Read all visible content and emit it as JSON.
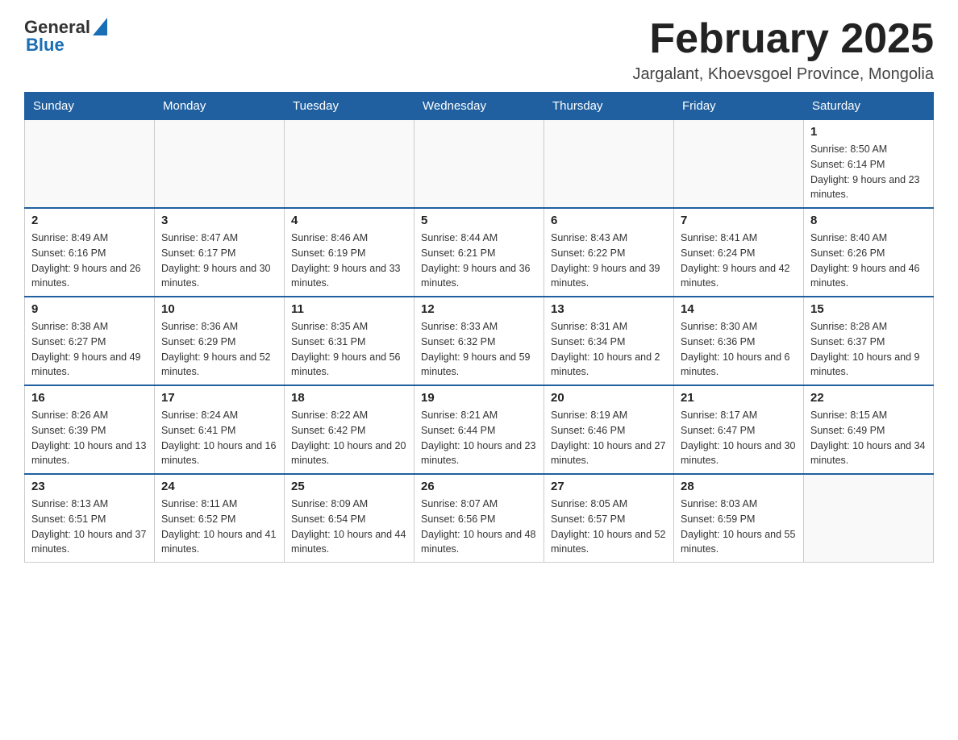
{
  "header": {
    "logo": {
      "general": "General",
      "blue": "Blue"
    },
    "title": "February 2025",
    "location": "Jargalant, Khoevsgoel Province, Mongolia"
  },
  "weekdays": [
    "Sunday",
    "Monday",
    "Tuesday",
    "Wednesday",
    "Thursday",
    "Friday",
    "Saturday"
  ],
  "weeks": [
    {
      "days": [
        {
          "number": "",
          "sunrise": "",
          "sunset": "",
          "daylight": "",
          "empty": true
        },
        {
          "number": "",
          "sunrise": "",
          "sunset": "",
          "daylight": "",
          "empty": true
        },
        {
          "number": "",
          "sunrise": "",
          "sunset": "",
          "daylight": "",
          "empty": true
        },
        {
          "number": "",
          "sunrise": "",
          "sunset": "",
          "daylight": "",
          "empty": true
        },
        {
          "number": "",
          "sunrise": "",
          "sunset": "",
          "daylight": "",
          "empty": true
        },
        {
          "number": "",
          "sunrise": "",
          "sunset": "",
          "daylight": "",
          "empty": true
        },
        {
          "number": "1",
          "sunrise": "Sunrise: 8:50 AM",
          "sunset": "Sunset: 6:14 PM",
          "daylight": "Daylight: 9 hours and 23 minutes.",
          "empty": false
        }
      ]
    },
    {
      "days": [
        {
          "number": "2",
          "sunrise": "Sunrise: 8:49 AM",
          "sunset": "Sunset: 6:16 PM",
          "daylight": "Daylight: 9 hours and 26 minutes.",
          "empty": false
        },
        {
          "number": "3",
          "sunrise": "Sunrise: 8:47 AM",
          "sunset": "Sunset: 6:17 PM",
          "daylight": "Daylight: 9 hours and 30 minutes.",
          "empty": false
        },
        {
          "number": "4",
          "sunrise": "Sunrise: 8:46 AM",
          "sunset": "Sunset: 6:19 PM",
          "daylight": "Daylight: 9 hours and 33 minutes.",
          "empty": false
        },
        {
          "number": "5",
          "sunrise": "Sunrise: 8:44 AM",
          "sunset": "Sunset: 6:21 PM",
          "daylight": "Daylight: 9 hours and 36 minutes.",
          "empty": false
        },
        {
          "number": "6",
          "sunrise": "Sunrise: 8:43 AM",
          "sunset": "Sunset: 6:22 PM",
          "daylight": "Daylight: 9 hours and 39 minutes.",
          "empty": false
        },
        {
          "number": "7",
          "sunrise": "Sunrise: 8:41 AM",
          "sunset": "Sunset: 6:24 PM",
          "daylight": "Daylight: 9 hours and 42 minutes.",
          "empty": false
        },
        {
          "number": "8",
          "sunrise": "Sunrise: 8:40 AM",
          "sunset": "Sunset: 6:26 PM",
          "daylight": "Daylight: 9 hours and 46 minutes.",
          "empty": false
        }
      ]
    },
    {
      "days": [
        {
          "number": "9",
          "sunrise": "Sunrise: 8:38 AM",
          "sunset": "Sunset: 6:27 PM",
          "daylight": "Daylight: 9 hours and 49 minutes.",
          "empty": false
        },
        {
          "number": "10",
          "sunrise": "Sunrise: 8:36 AM",
          "sunset": "Sunset: 6:29 PM",
          "daylight": "Daylight: 9 hours and 52 minutes.",
          "empty": false
        },
        {
          "number": "11",
          "sunrise": "Sunrise: 8:35 AM",
          "sunset": "Sunset: 6:31 PM",
          "daylight": "Daylight: 9 hours and 56 minutes.",
          "empty": false
        },
        {
          "number": "12",
          "sunrise": "Sunrise: 8:33 AM",
          "sunset": "Sunset: 6:32 PM",
          "daylight": "Daylight: 9 hours and 59 minutes.",
          "empty": false
        },
        {
          "number": "13",
          "sunrise": "Sunrise: 8:31 AM",
          "sunset": "Sunset: 6:34 PM",
          "daylight": "Daylight: 10 hours and 2 minutes.",
          "empty": false
        },
        {
          "number": "14",
          "sunrise": "Sunrise: 8:30 AM",
          "sunset": "Sunset: 6:36 PM",
          "daylight": "Daylight: 10 hours and 6 minutes.",
          "empty": false
        },
        {
          "number": "15",
          "sunrise": "Sunrise: 8:28 AM",
          "sunset": "Sunset: 6:37 PM",
          "daylight": "Daylight: 10 hours and 9 minutes.",
          "empty": false
        }
      ]
    },
    {
      "days": [
        {
          "number": "16",
          "sunrise": "Sunrise: 8:26 AM",
          "sunset": "Sunset: 6:39 PM",
          "daylight": "Daylight: 10 hours and 13 minutes.",
          "empty": false
        },
        {
          "number": "17",
          "sunrise": "Sunrise: 8:24 AM",
          "sunset": "Sunset: 6:41 PM",
          "daylight": "Daylight: 10 hours and 16 minutes.",
          "empty": false
        },
        {
          "number": "18",
          "sunrise": "Sunrise: 8:22 AM",
          "sunset": "Sunset: 6:42 PM",
          "daylight": "Daylight: 10 hours and 20 minutes.",
          "empty": false
        },
        {
          "number": "19",
          "sunrise": "Sunrise: 8:21 AM",
          "sunset": "Sunset: 6:44 PM",
          "daylight": "Daylight: 10 hours and 23 minutes.",
          "empty": false
        },
        {
          "number": "20",
          "sunrise": "Sunrise: 8:19 AM",
          "sunset": "Sunset: 6:46 PM",
          "daylight": "Daylight: 10 hours and 27 minutes.",
          "empty": false
        },
        {
          "number": "21",
          "sunrise": "Sunrise: 8:17 AM",
          "sunset": "Sunset: 6:47 PM",
          "daylight": "Daylight: 10 hours and 30 minutes.",
          "empty": false
        },
        {
          "number": "22",
          "sunrise": "Sunrise: 8:15 AM",
          "sunset": "Sunset: 6:49 PM",
          "daylight": "Daylight: 10 hours and 34 minutes.",
          "empty": false
        }
      ]
    },
    {
      "days": [
        {
          "number": "23",
          "sunrise": "Sunrise: 8:13 AM",
          "sunset": "Sunset: 6:51 PM",
          "daylight": "Daylight: 10 hours and 37 minutes.",
          "empty": false
        },
        {
          "number": "24",
          "sunrise": "Sunrise: 8:11 AM",
          "sunset": "Sunset: 6:52 PM",
          "daylight": "Daylight: 10 hours and 41 minutes.",
          "empty": false
        },
        {
          "number": "25",
          "sunrise": "Sunrise: 8:09 AM",
          "sunset": "Sunset: 6:54 PM",
          "daylight": "Daylight: 10 hours and 44 minutes.",
          "empty": false
        },
        {
          "number": "26",
          "sunrise": "Sunrise: 8:07 AM",
          "sunset": "Sunset: 6:56 PM",
          "daylight": "Daylight: 10 hours and 48 minutes.",
          "empty": false
        },
        {
          "number": "27",
          "sunrise": "Sunrise: 8:05 AM",
          "sunset": "Sunset: 6:57 PM",
          "daylight": "Daylight: 10 hours and 52 minutes.",
          "empty": false
        },
        {
          "number": "28",
          "sunrise": "Sunrise: 8:03 AM",
          "sunset": "Sunset: 6:59 PM",
          "daylight": "Daylight: 10 hours and 55 minutes.",
          "empty": false
        },
        {
          "number": "",
          "sunrise": "",
          "sunset": "",
          "daylight": "",
          "empty": true
        }
      ]
    }
  ]
}
